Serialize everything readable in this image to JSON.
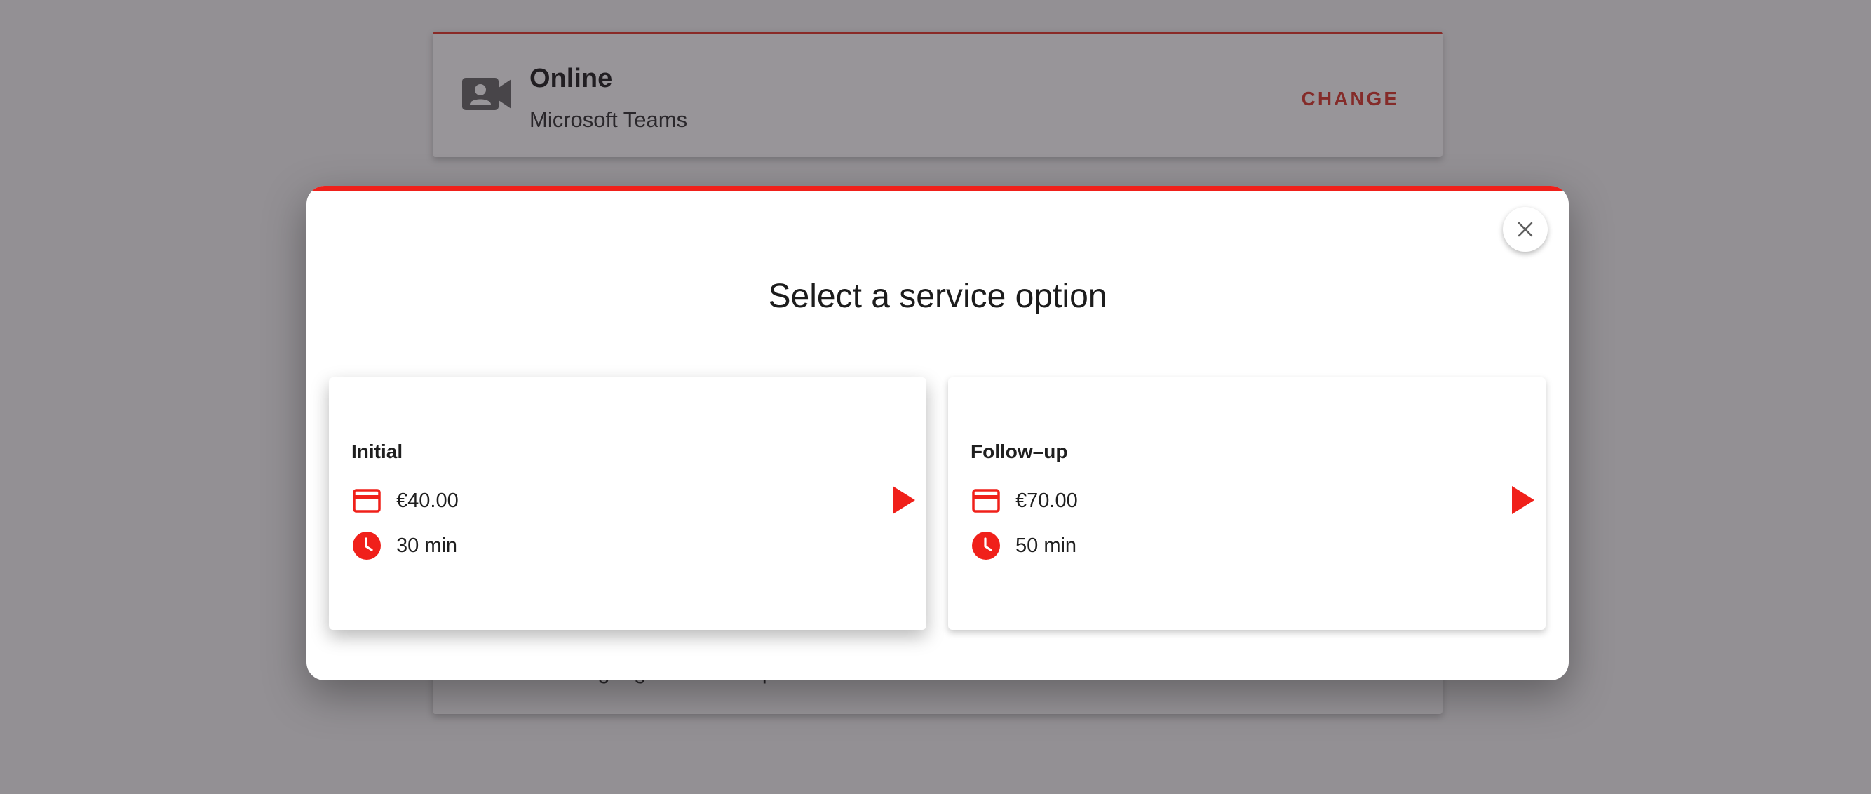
{
  "background": {
    "location": {
      "title": "Online",
      "subtitle": "Microsoft Teams",
      "change_label": "CHANGE",
      "icon": "video-camera-person-icon"
    },
    "description_text": "can learn a language from our specialist."
  },
  "dialog": {
    "title": "Select a service option",
    "close_icon": "close-icon",
    "options": [
      {
        "name": "Initial",
        "price": "€40.00",
        "duration": "30 min"
      },
      {
        "name": "Follow–up",
        "price": "€70.00",
        "duration": "50 min"
      }
    ]
  },
  "colors": {
    "accent": "#f0201a",
    "change_text": "#d62a1e",
    "overlay": "rgba(50,44,52,0.5)"
  },
  "icons": {
    "price": "credit-card-icon",
    "duration": "clock-icon",
    "select": "play-arrow-icon"
  }
}
